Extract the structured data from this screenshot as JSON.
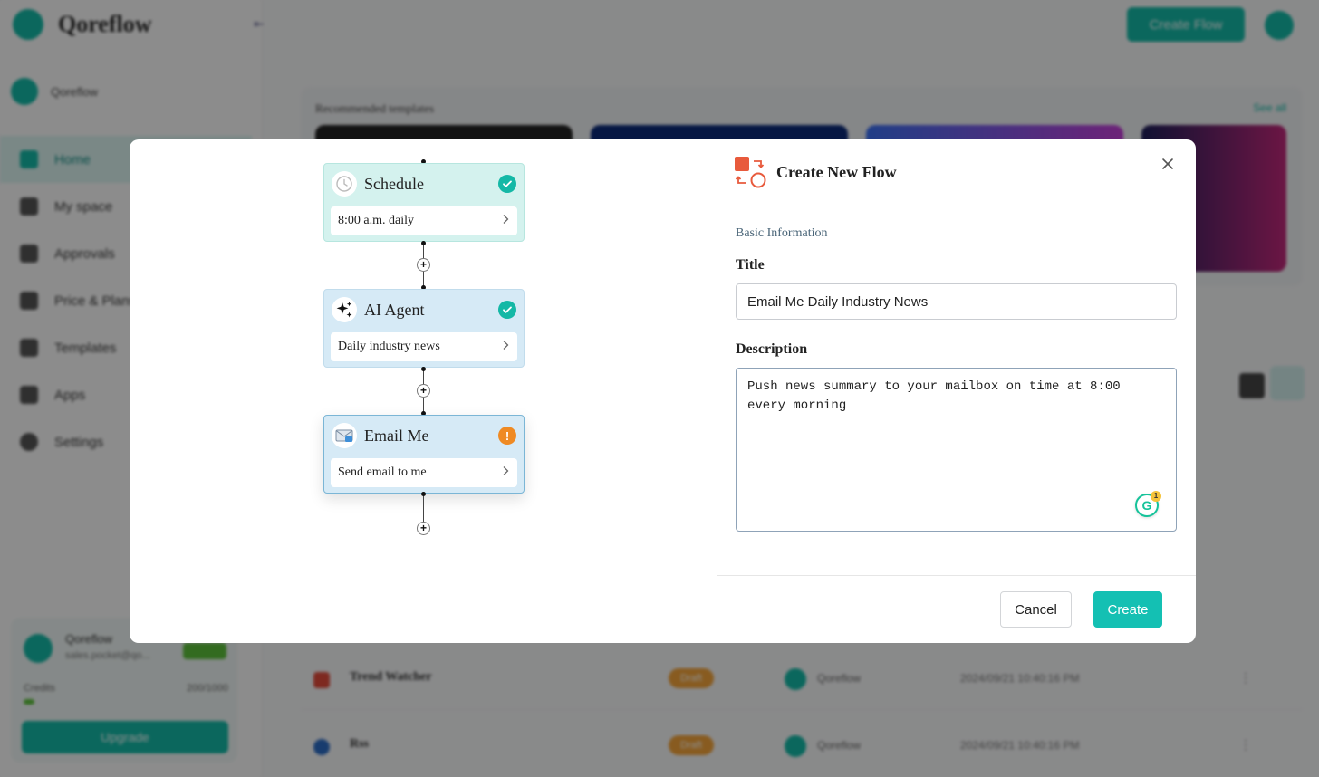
{
  "background": {
    "brand": "Qoreflow",
    "workspace_name": "Qoreflow",
    "nav": [
      {
        "label": "Home",
        "active": true
      },
      {
        "label": "My space"
      },
      {
        "label": "Approvals"
      },
      {
        "label": "Price & Plans"
      },
      {
        "label": "Templates"
      },
      {
        "label": "Apps"
      },
      {
        "label": "Settings"
      }
    ],
    "user": {
      "name": "Qoreflow",
      "email": "sales.pocket@qo...",
      "credits_label": "Credits",
      "credits_value": "200/1000",
      "upgrade_label": "Upgrade"
    },
    "create_flow_label": "Create Flow",
    "recommended_title": "Recommended templates",
    "see_all": "See all",
    "rows": [
      {
        "name": "Trend Watcher",
        "tag": "Draft",
        "owner": "Qoreflow",
        "date": "2024/09/21 10:40:16 PM"
      },
      {
        "name": "Rss",
        "tag": "Draft",
        "owner": "Qoreflow",
        "date": "2024/09/21 10:40:16 PM"
      }
    ]
  },
  "modal": {
    "title": "Create New Flow",
    "close_icon": "close-icon",
    "section_label": "Basic Information",
    "title_label": "Title",
    "title_value": "Email Me Daily Industry News",
    "description_label": "Description",
    "description_value": "Push news summary to your mailbox on time at 8:00 every morning",
    "grammarly_count": "1",
    "cancel_label": "Cancel",
    "create_label": "Create",
    "accent_color": "#14c0b3"
  },
  "flow": {
    "nodes": [
      {
        "title": "Schedule",
        "detail": "8:00 a.m. daily",
        "icon": "clock-icon",
        "status": "complete"
      },
      {
        "title": "AI Agent",
        "detail": "Daily industry news",
        "icon": "sparkles-icon",
        "status": "complete"
      },
      {
        "title": "Email Me",
        "detail": "Send email to me",
        "icon": "envelope-icon",
        "status": "warning"
      }
    ]
  }
}
